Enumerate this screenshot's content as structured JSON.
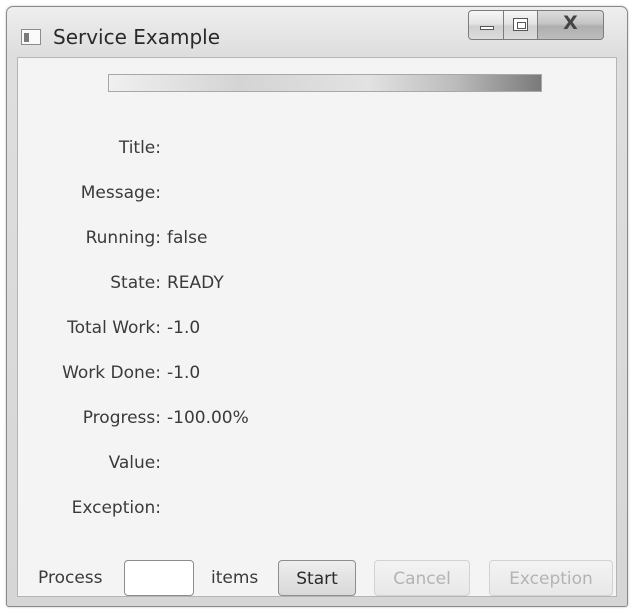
{
  "window": {
    "title": "Service Example",
    "close_glyph": "X",
    "icons": [
      "app-icon",
      "minimize-icon",
      "maximize-icon",
      "close-icon"
    ]
  },
  "progress": {
    "value": 1.0
  },
  "fields": [
    {
      "label": "Title:",
      "value": ""
    },
    {
      "label": "Message:",
      "value": ""
    },
    {
      "label": "Running:",
      "value": "false"
    },
    {
      "label": "State:",
      "value": "READY"
    },
    {
      "label": "Total Work:",
      "value": "-1.0"
    },
    {
      "label": "Work Done:",
      "value": "-1.0"
    },
    {
      "label": "Progress:",
      "value": "-100.00%"
    },
    {
      "label": "Value:",
      "value": ""
    },
    {
      "label": "Exception:",
      "value": ""
    }
  ],
  "footer": {
    "process_label": "Process",
    "items_value": "",
    "items_label": "items",
    "start_label": "Start",
    "cancel_label": "Cancel",
    "exception_label": "Exception"
  }
}
